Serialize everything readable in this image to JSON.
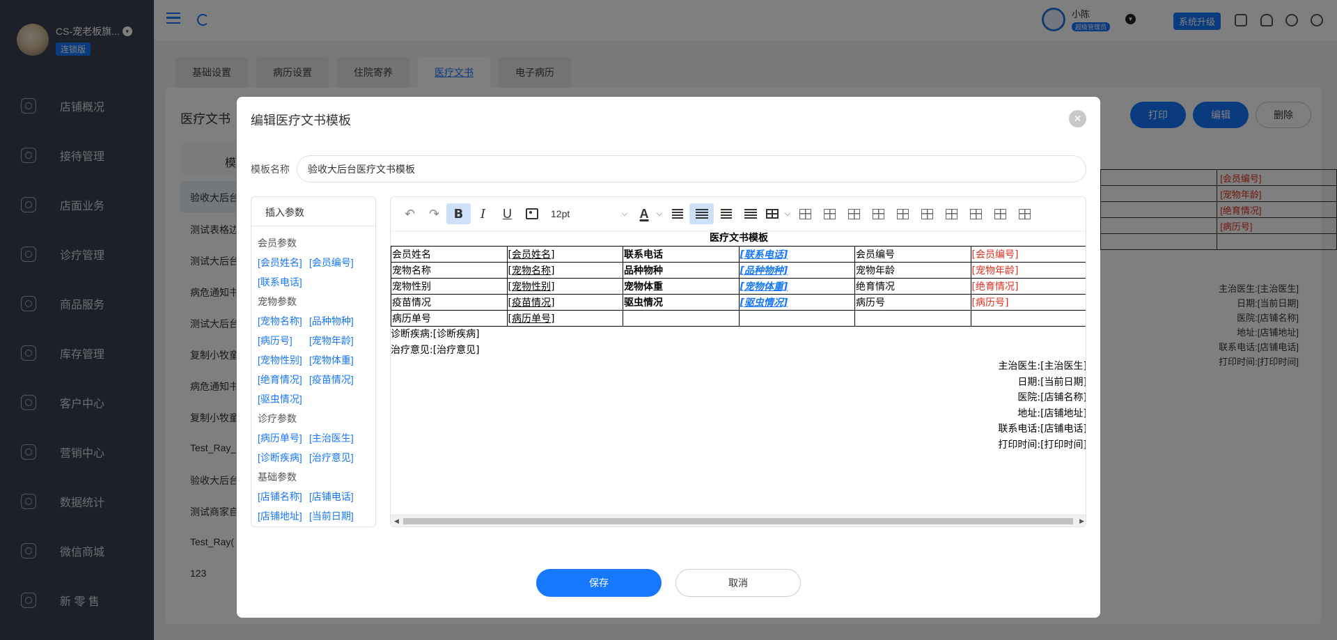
{
  "sidebar": {
    "shop_name": "CS-宠老板旗...",
    "badge": "连锁版",
    "items": [
      {
        "label": "店铺概况"
      },
      {
        "label": "接待管理"
      },
      {
        "label": "店面业务"
      },
      {
        "label": "诊疗管理"
      },
      {
        "label": "商品服务"
      },
      {
        "label": "库存管理"
      },
      {
        "label": "客户中心"
      },
      {
        "label": "营销中心"
      },
      {
        "label": "数据统计"
      },
      {
        "label": "微信商城"
      },
      {
        "label": "新 零 售"
      }
    ]
  },
  "topbar": {
    "user_name": "小陈",
    "user_role": "超级管理员",
    "upgrade_label": "系统升级"
  },
  "tabs": [
    {
      "label": "基础设置"
    },
    {
      "label": "病历设置"
    },
    {
      "label": "住院寄养"
    },
    {
      "label": "医疗文书"
    },
    {
      "label": "电子病历"
    }
  ],
  "background": {
    "title": "医疗文书",
    "list_header": "模",
    "buttons": {
      "print": "打印",
      "edit": "编辑",
      "delete": "删除"
    },
    "list_items": [
      "验收大后台",
      "测试表格边",
      "测试大后台",
      "病危通知书",
      "测试大后台",
      "复制小牧童",
      "病危通知书",
      "复制小牧童",
      "Test_Ray_",
      "验收大后台",
      "测试商家自",
      "Test_Ray(",
      "123"
    ],
    "table_cells": [
      "[会员编号]",
      "[宠物年龄]",
      "[绝育情况]",
      "[病历号]"
    ],
    "sign_lines": [
      "主治医生:[主治医生]",
      "日期:[当前日期]",
      "医院:[店铺名称]",
      "地址:[店铺地址]",
      "联系电话:[店铺电话]",
      "打印时间:[打印时间]"
    ]
  },
  "modal": {
    "title": "编辑医疗文书模板",
    "name_label": "模板名称",
    "name_value": "验收大后台医疗文书模板",
    "save_label": "保存",
    "cancel_label": "取消"
  },
  "params": {
    "header": "插入参数",
    "groups": [
      {
        "title": "会员参数",
        "rows": [
          [
            "[会员姓名]",
            "[会员编号]"
          ],
          [
            "[联系电话]"
          ]
        ]
      },
      {
        "title": "宠物参数",
        "rows": [
          [
            "[宠物名称]",
            "[品种物种]"
          ],
          [
            "[病历号]",
            "[宠物年龄]"
          ],
          [
            "[宠物性别]",
            "[宠物体重]"
          ],
          [
            "[绝育情况]",
            "[疫苗情况]"
          ],
          [
            "[驱虫情况]"
          ]
        ]
      },
      {
        "title": "诊疗参数",
        "rows": [
          [
            "[病历单号]",
            "[主治医生]"
          ],
          [
            "[诊断疾病]",
            "[治疗意见]"
          ]
        ]
      },
      {
        "title": "基础参数",
        "rows": [
          [
            "[店铺名称]",
            "[店铺电话]"
          ],
          [
            "[店铺地址]",
            "[当前日期]"
          ]
        ]
      }
    ]
  },
  "editor": {
    "font_size": "12pt",
    "font_color_label": "A",
    "doc_title": "医疗文书模板",
    "table": [
      [
        "会员姓名",
        "[会员姓名]",
        "联系电话",
        "[联系电话]",
        "会员编号",
        "[会员编号]"
      ],
      [
        "宠物名称",
        "[宠物名称]",
        "品种物种",
        "[品种物种]",
        "宠物年龄",
        "[宠物年龄]"
      ],
      [
        "宠物性别",
        "[宠物性别]",
        "宠物体重",
        "[宠物体重]",
        "绝育情况",
        "[绝育情况]"
      ],
      [
        "疫苗情况",
        "[疫苗情况]",
        "驱虫情况",
        "[驱虫情况]",
        "病历号",
        "[病历号]"
      ],
      [
        "病历单号",
        "[病历单号]",
        "",
        "",
        "",
        ""
      ]
    ],
    "lines": [
      "诊断疾病:[诊断疾病]",
      "治疗意见:[治疗意见]"
    ],
    "sign_lines": [
      "主治医生:[主治医生]",
      "日期:[当前日期]",
      "医院:[店铺名称]",
      "地址:[店铺地址]",
      "联系电话:[店铺电话]",
      "打印时间:[打印时间]"
    ]
  },
  "icons": {
    "undo": "undo-icon",
    "redo": "redo-icon",
    "bold": "bold-icon",
    "italic": "italic-icon",
    "underline": "underline-icon",
    "image": "image-icon",
    "close": "close-icon"
  },
  "colors": {
    "accent": "#1677ff",
    "param_red": "#e0301e",
    "sidebar": "#3a4150"
  }
}
